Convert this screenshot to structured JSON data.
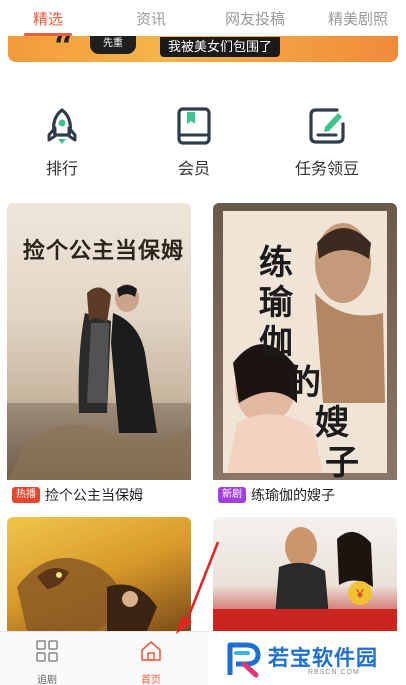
{
  "tabs": [
    {
      "label": "精选",
      "active": true
    },
    {
      "label": "资讯",
      "active": false
    },
    {
      "label": "网友投稿",
      "active": false
    },
    {
      "label": "精美剧照",
      "active": false
    }
  ],
  "banner": {
    "pill": "先重",
    "text": "我被美女们包围了"
  },
  "quick_actions": [
    {
      "label": "排行",
      "icon": "rocket-icon"
    },
    {
      "label": "会员",
      "icon": "book-icon"
    },
    {
      "label": "任务领豆",
      "icon": "task-edit-icon"
    }
  ],
  "cards": [
    {
      "badge": "热播",
      "title": "捡个公主当保姆",
      "poster_title": "捡个公主当保姆"
    },
    {
      "badge": "新剧",
      "title": "练瑜伽的嫂子",
      "poster_title": "练瑜伽的嫂子"
    },
    {
      "badge": "",
      "title": "",
      "poster_title": ""
    },
    {
      "badge": "",
      "title": "",
      "poster_title": ""
    }
  ],
  "bottom_nav": [
    {
      "label": "追剧",
      "icon": "grid-icon",
      "active": false
    },
    {
      "label": "首页",
      "icon": "home-icon",
      "active": true
    }
  ],
  "watermark": {
    "text": "若宝软件园",
    "sub": "RBSCN.COM"
  },
  "colors": {
    "accent": "#ef5b3d",
    "icon_dark": "#2f3d4a",
    "icon_green": "#3cc48a",
    "hot_badge": "#e8452f",
    "new_badge": "#a23fe0"
  }
}
